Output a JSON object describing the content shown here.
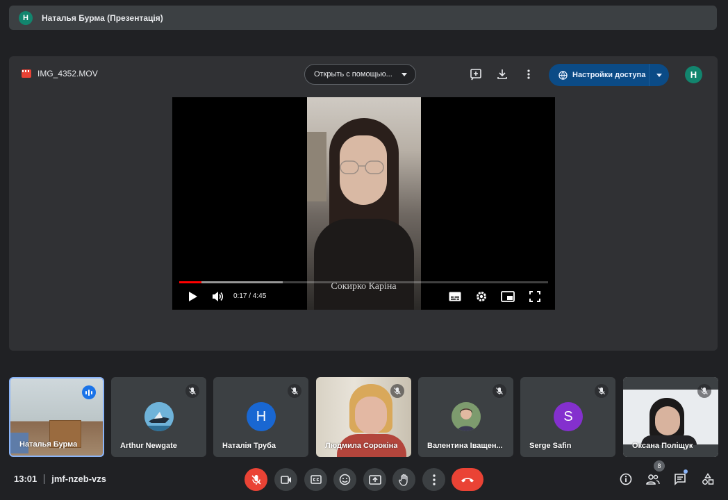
{
  "top_bar": {
    "avatar_initial": "Н",
    "title": "Наталья Бурма (Презентація)"
  },
  "presentation": {
    "file_name": "IMG_4352.MOV",
    "open_with_label": "Открыть с помощью...",
    "access_button_label": "Настройки доступа",
    "user_avatar_initial": "Н",
    "icons": [
      "add-to-drive-icon",
      "download-icon",
      "more-vert-icon",
      "globe-icon"
    ]
  },
  "video": {
    "caption": "Сокирко Каріна",
    "time_display": "0:17 / 4:45",
    "progress_played_fraction": 0.06,
    "progress_buffered_fraction": 0.28,
    "controls": [
      "play-icon",
      "volume-icon",
      "subtitles-icon",
      "settings-icon",
      "miniplayer-icon",
      "fullscreen-icon"
    ]
  },
  "participants": [
    {
      "name": "Наталья Бурма",
      "avatar": "",
      "speaking": true,
      "mic_muted": false
    },
    {
      "name": "Arthur Newgate",
      "avatar": "",
      "avatar_color": "#3b8ec2",
      "mic_muted": true
    },
    {
      "name": "Наталія Труба",
      "avatar": "Н",
      "avatar_color": "#1967d2",
      "mic_muted": true
    },
    {
      "name": "Людмила Сорокіна",
      "avatar": "",
      "mic_muted": true
    },
    {
      "name": "Валентина Іващен...",
      "avatar": "",
      "avatar_color": "#5f7a5a",
      "mic_muted": true
    },
    {
      "name": "Serge Safin",
      "avatar": "S",
      "avatar_color": "#8430ce",
      "mic_muted": true
    },
    {
      "name": "Оксана Поліщук",
      "avatar": "",
      "mic_muted": true
    }
  ],
  "bottom": {
    "time": "13:01",
    "meeting_code": "jmf-nzeb-vzs",
    "participant_count": "8",
    "colors": {
      "end_call": "#ea4335",
      "mic_off": "#ea4335",
      "accent": "#8ab4f8"
    }
  }
}
